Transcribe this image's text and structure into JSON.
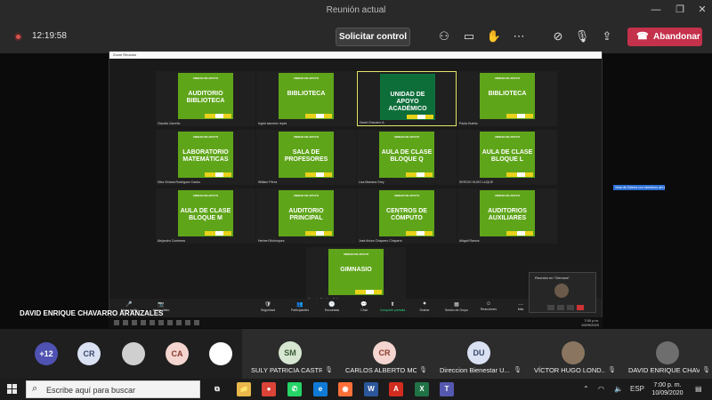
{
  "window": {
    "title": "Reunión actual",
    "controls": {
      "minimize": "—",
      "maximize": "❐",
      "close": "✕"
    }
  },
  "toolbar": {
    "timer": "12:19:58",
    "request_control": "Solicitar control",
    "leave": "Abandonar",
    "icons": [
      "people-icon",
      "chat-icon",
      "raise-hand-icon",
      "more-icon",
      "camera-off-icon",
      "mic-off-icon",
      "share-icon"
    ]
  },
  "zoom": {
    "window_title": "Zoom Reunión",
    "tiles": [
      {
        "panel_main": "AUDITORIO\nBIBLIOTECA",
        "panel_sub": "UNIDAD DE APOYO",
        "name": "Claudia Carreño",
        "dark": false
      },
      {
        "panel_main": "BIBLIOTECA",
        "panel_sub": "UNIDAD DE APOYO",
        "name": "Ingrid sanchez reyes",
        "dark": false
      },
      {
        "panel_main": "UNIDAD DE\nAPOYO\nACADÉMICO",
        "panel_sub": "",
        "name": "David Chavarro A.",
        "dark": true,
        "selected": true
      },
      {
        "panel_main": "BIBLIOTECA",
        "panel_sub": "UNIDAD DE APOYO",
        "name": "Paola Huerta",
        "dark": false
      },
      {
        "panel_main": "LABORATORIO\nMATEMÁTICAS",
        "panel_sub": "UNIDAD DE APOYO",
        "name": "Diba Viviana Rodríguez Castro",
        "dark": false
      },
      {
        "panel_main": "SALA DE\nPROFESORES",
        "panel_sub": "UNIDAD DE APOYO",
        "name": "William Pérez",
        "dark": false
      },
      {
        "panel_main": "AULA DE CLASE\nBLOQUE Q",
        "panel_sub": "UNIDAD DE APOYO",
        "name": "Liza Mariana Grey",
        "dark": false
      },
      {
        "panel_main": "AULA DE CLASE\nBLOQUE L",
        "panel_sub": "UNIDAD DE APOYO",
        "name": "SERGIO HUGO LUQUE",
        "dark": false
      },
      {
        "panel_main": "AULA DE CLASE\nBLOQUE M",
        "panel_sub": "UNIDAD DE APOYO",
        "name": "Alejandro Contreras",
        "dark": false
      },
      {
        "panel_main": "AUDITORIO\nPRINCIPAL",
        "panel_sub": "UNIDAD DE APOYO",
        "name": "Herbert Bohórquez",
        "dark": false
      },
      {
        "panel_main": "CENTROS DE\nCÓMPUTO",
        "panel_sub": "UNIDAD DE APOYO",
        "name": "José Arturo Chaparro Chaparro",
        "dark": false
      },
      {
        "panel_main": "AUDITORIOS\nAUXILIARES",
        "panel_sub": "UNIDAD DE APOYO",
        "name": "Abigail Ramos",
        "dark": false
      },
      {
        "panel_main": "GIMNASIO",
        "panel_sub": "UNIDAD DE APOYO",
        "name": "Marcelo Ordoñez Peña",
        "dark": false
      }
    ],
    "tooltip": "Vista de Galería con miembros del equipo",
    "mini": {
      "title": "Reunión en \"Gemora\""
    },
    "controls": [
      {
        "icon": "🎤",
        "label": "Iniciar audio"
      },
      {
        "icon": "📷",
        "label": "Iniciar video"
      },
      {
        "icon": "🛡",
        "label": "Seguridad"
      },
      {
        "icon": "👥",
        "label": "Participantes"
      },
      {
        "icon": "🕒",
        "label": "Encuestas"
      },
      {
        "icon": "💬",
        "label": "Chat"
      },
      {
        "icon": "⬆",
        "label": "Compartir pantalla",
        "green": true
      },
      {
        "icon": "⏺",
        "label": "Grabar"
      },
      {
        "icon": "▦",
        "label": "Sesión de Grupo"
      },
      {
        "icon": "☺",
        "label": "Reacciones"
      },
      {
        "icon": "…",
        "label": "Más"
      }
    ]
  },
  "speaker_label": "DAVID ENRIQUE CHAVARRO ARANZALES",
  "inner_clock": {
    "time": "7:00 p.m.",
    "date": "10/09/2020"
  },
  "roster": {
    "mini_avatars": [
      {
        "label": "+12",
        "bg": "#4f52b2",
        "fg": "#ffffff"
      },
      {
        "label": "CR",
        "bg": "#d9e1f2",
        "fg": "#3a4a6b"
      },
      {
        "label": "",
        "bg": "#cfcfcf",
        "fg": "#333333"
      },
      {
        "label": "CA",
        "bg": "#f4d5cf",
        "fg": "#8a3b2e"
      },
      {
        "label": "",
        "bg": "#ffffff",
        "fg": "#1f7a2e"
      }
    ],
    "participants": [
      {
        "initials": "SM",
        "name": "SULY PATRICIA CASTR...",
        "bg": "#d6e6d1",
        "fg": "#3c5a36"
      },
      {
        "initials": "CR",
        "name": "CARLOS ALBERTO MO...",
        "bg": "#f4d5cf",
        "fg": "#8a3b2e"
      },
      {
        "initials": "DU",
        "name": "Direccion Bienestar U...",
        "bg": "#d9e1f2",
        "fg": "#3a4a6b"
      },
      {
        "initials": "",
        "name": "VÍCTOR HUGO LOND...",
        "bg": "#8a7560",
        "fg": "#ffffff"
      },
      {
        "initials": "",
        "name": "DAVID ENRIQUE CHAVARR...",
        "bg": "#6e6e6e",
        "fg": "#ffffff"
      }
    ]
  },
  "taskbar": {
    "search_placeholder": "Escribe aquí para buscar",
    "apps": [
      {
        "name": "task-view",
        "glyph": "⧉",
        "bg": "#1b1b1b"
      },
      {
        "name": "file-explorer",
        "glyph": "📁",
        "bg": "#e8b84a"
      },
      {
        "name": "chrome",
        "glyph": "●",
        "bg": "#db4437"
      },
      {
        "name": "whatsapp",
        "glyph": "✆",
        "bg": "#25d366"
      },
      {
        "name": "edge",
        "glyph": "e",
        "bg": "#0f7bd7"
      },
      {
        "name": "firefox",
        "glyph": "◉",
        "bg": "#ff7139"
      },
      {
        "name": "word",
        "glyph": "W",
        "bg": "#2b579a"
      },
      {
        "name": "acrobat",
        "glyph": "A",
        "bg": "#d12c1f"
      },
      {
        "name": "excel",
        "glyph": "X",
        "bg": "#217346"
      },
      {
        "name": "teams",
        "glyph": "T",
        "bg": "#5558af"
      }
    ],
    "lang": "ESP",
    "time": "7:00 p. m.",
    "date": "10/09/2020"
  }
}
